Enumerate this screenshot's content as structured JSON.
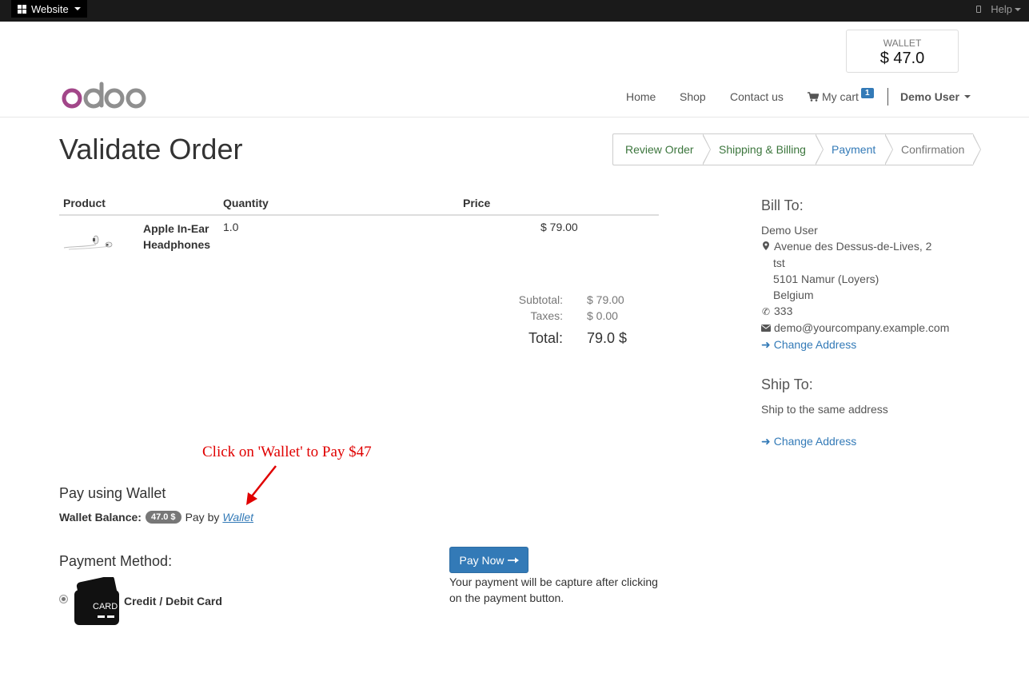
{
  "topbar": {
    "website_label": "Website",
    "help_label": "Help"
  },
  "wallet_widget": {
    "label": "WALLET",
    "amount": "$ 47.0"
  },
  "nav": {
    "home": "Home",
    "shop": "Shop",
    "contact": "Contact us",
    "cart": "My cart",
    "cart_count": "1",
    "user": "Demo User"
  },
  "page": {
    "title": "Validate Order"
  },
  "steps": [
    {
      "label": "Review Order",
      "state": "done"
    },
    {
      "label": "Shipping & Billing",
      "state": "done"
    },
    {
      "label": "Payment",
      "state": "active"
    },
    {
      "label": "Confirmation",
      "state": "todo"
    }
  ],
  "cart": {
    "headers": {
      "product": "Product",
      "quantity": "Quantity",
      "price": "Price"
    },
    "lines": [
      {
        "name": "Apple In-Ear Headphones",
        "quantity": "1.0",
        "price": "$ 79.00"
      }
    ],
    "subtotal_label": "Subtotal:",
    "subtotal": "$ 79.00",
    "taxes_label": "Taxes:",
    "taxes": "$ 0.00",
    "total_label": "Total:",
    "total": "79.0 $"
  },
  "annotation": {
    "text": "Click on 'Wallet' to  Pay $47",
    "color": "#e00000"
  },
  "wallet_pay": {
    "heading": "Pay using Wallet",
    "balance_label": "Wallet Balance:",
    "balance": "47.0 $",
    "pay_by": "Pay by",
    "link": "Wallet"
  },
  "payment": {
    "heading": "Payment Method:",
    "method_label": "Credit / Debit Card",
    "card_text": "CARD",
    "button": "Pay Now",
    "note": "Your payment will be capture after clicking on the payment button."
  },
  "bill_to": {
    "heading": "Bill To:",
    "name": "Demo User",
    "street": "Avenue des Dessus-de-Lives, 2",
    "street2": "tst",
    "city": "5101 Namur (Loyers)",
    "country": "Belgium",
    "phone": "333",
    "email": "demo@yourcompany.example.com",
    "change": "Change Address"
  },
  "ship_to": {
    "heading": "Ship To:",
    "text": "Ship to the same address",
    "change": "Change Address"
  },
  "colors": {
    "primary": "#337ab7",
    "done_step": "#3c763d",
    "logo_o1": "#a24689",
    "logo_grey": "#8f8f8f"
  }
}
